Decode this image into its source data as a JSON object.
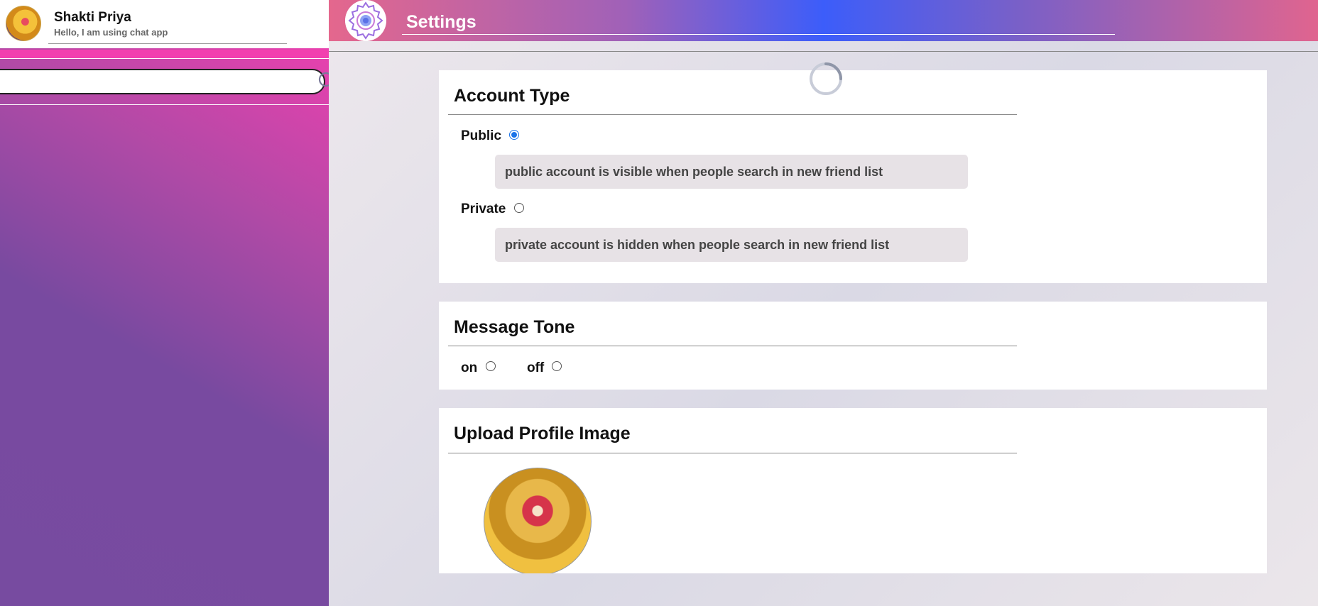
{
  "sidebar": {
    "user_name": "Shakti Priya",
    "user_status": "Hello, I am using chat app",
    "search_placeholder": ""
  },
  "header": {
    "title": "Settings"
  },
  "account_type": {
    "title": "Account Type",
    "public_label": "Public",
    "public_desc": "public account is visible when people search in new friend list",
    "private_label": "Private",
    "private_desc": "private account is hidden when people search in new friend list",
    "selected": "Public"
  },
  "message_tone": {
    "title": "Message Tone",
    "on_label": "on",
    "off_label": "off"
  },
  "upload": {
    "title": "Upload Profile Image"
  },
  "colors": {
    "accent": "#3c5dfa",
    "sidebar_pink": "#f23faf",
    "sidebar_purple": "#774ba0",
    "radio_checked": "#1a73e8"
  }
}
